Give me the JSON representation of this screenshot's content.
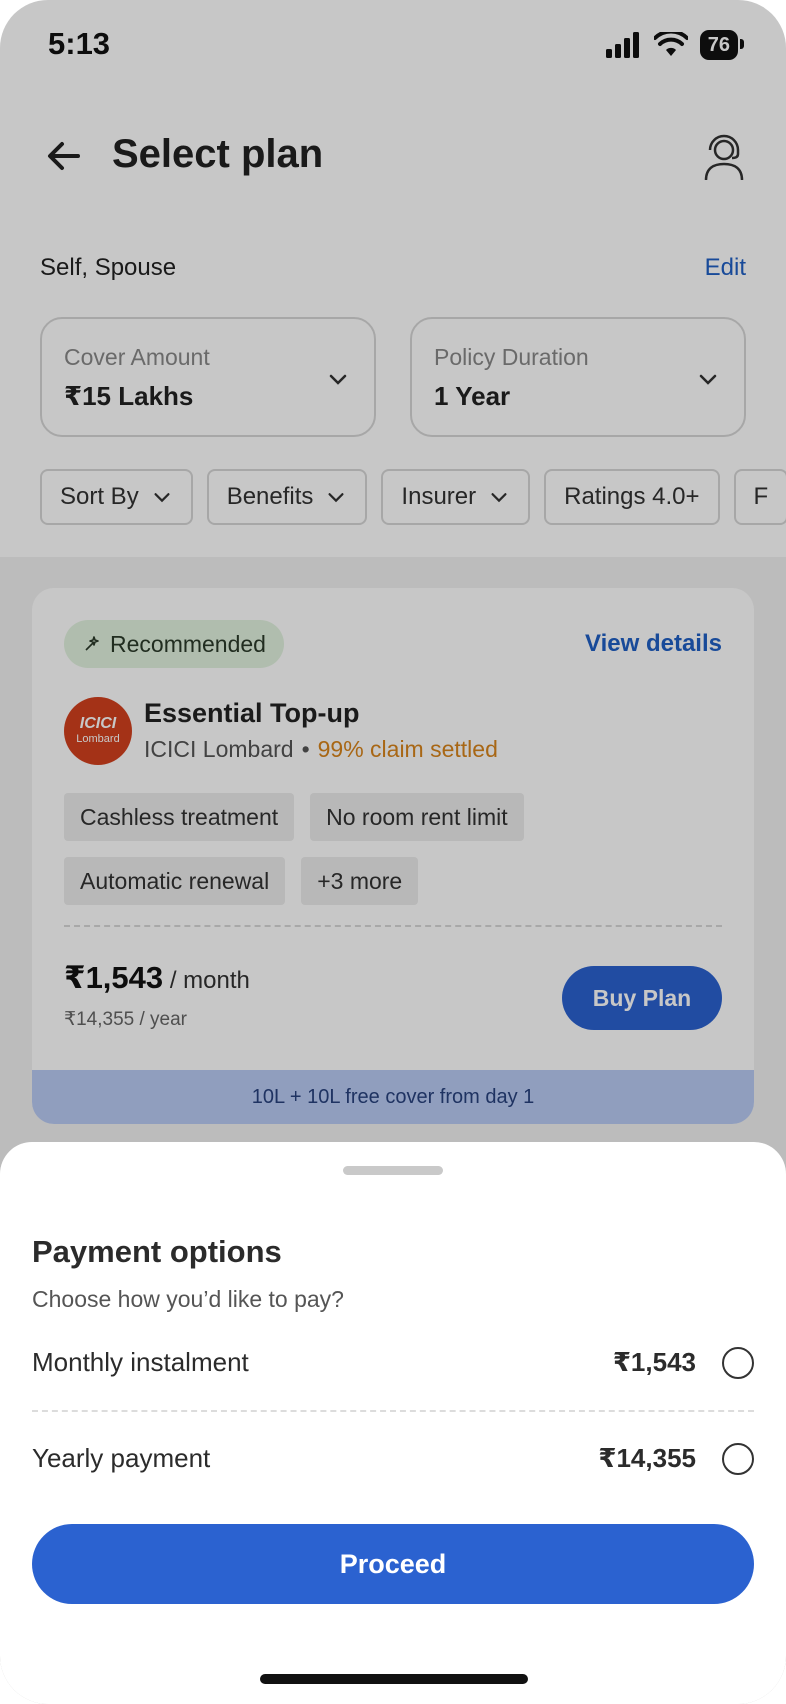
{
  "status_bar": {
    "time": "5:13",
    "battery": "76"
  },
  "header": {
    "title": "Select plan"
  },
  "members": {
    "text": "Self, Spouse",
    "edit": "Edit"
  },
  "filters": {
    "cover": {
      "label": "Cover Amount",
      "value": "₹15 Lakhs"
    },
    "duration": {
      "label": "Policy Duration",
      "value": "1 Year"
    },
    "chips": [
      "Sort By",
      "Benefits",
      "Insurer",
      "Ratings 4.0+",
      "F"
    ]
  },
  "plan": {
    "badge": "Recommended",
    "view_details": "View details",
    "logo_line1": "ICICI",
    "logo_line2": "Lombard",
    "name": "Essential Top-up",
    "insurer": "ICICI Lombard",
    "dot": "•",
    "claim": "99% claim settled",
    "features": [
      "Cashless treatment",
      "No room rent limit",
      "Automatic renewal",
      "+3 more"
    ],
    "price_month": "₹1,543",
    "price_month_suffix": "/ month",
    "price_year": "₹14,355 / year",
    "buy_label": "Buy Plan",
    "free_cover": "10L + 10L free cover from day 1"
  },
  "sheet": {
    "title": "Payment options",
    "subtitle": "Choose how you’d like to pay?",
    "options": [
      {
        "label": "Monthly instalment",
        "price": "₹1,543"
      },
      {
        "label": "Yearly payment",
        "price": "₹14,355"
      }
    ],
    "proceed": "Proceed"
  },
  "colors": {
    "primary": "#2b62d0",
    "link": "#1f5fc4",
    "claim": "#d8841c",
    "badge_bg": "#e2f3df"
  }
}
